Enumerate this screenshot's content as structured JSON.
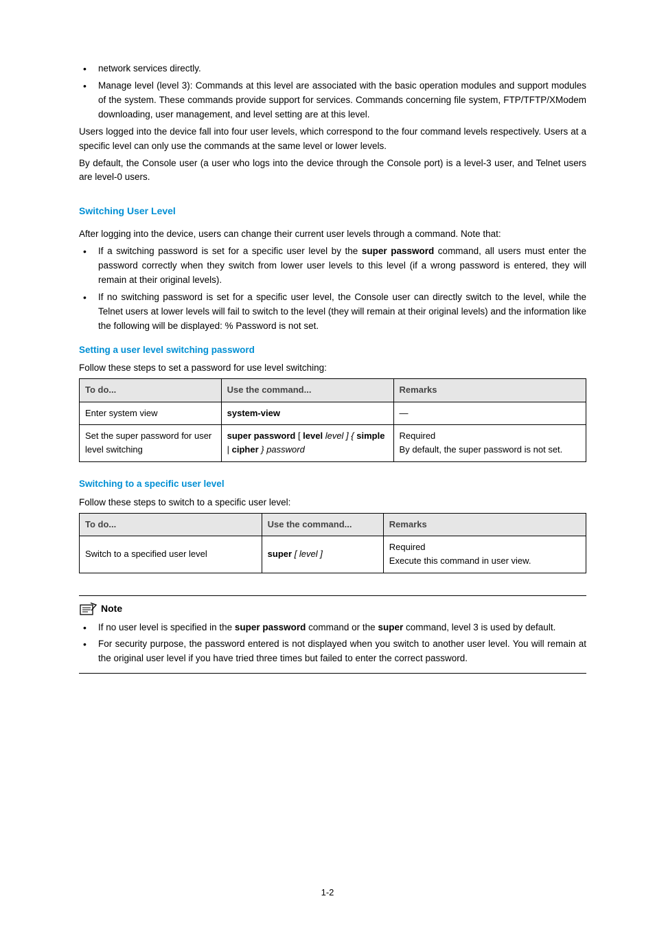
{
  "intro": {
    "bullet1_pre": "network services directly.",
    "bullet2": "Manage level (level 3): Commands at this level are associated with the basic operation modules and support modules of the system. These commands provide support for services. Commands concerning file system, FTP/TFTP/XModem downloading, user management, and level setting are at this level.",
    "p1": "Users logged into the device fall into four user levels, which correspond to the four command levels respectively. Users at a specific level can only use the commands at the same level or lower levels.",
    "p2": "By default, the Console user (a user who logs into the device through the Console port) is a level-3 user, and Telnet users are level-0 users."
  },
  "switching": {
    "heading": "Switching User Level",
    "p1": "After logging into the device, users can change their current user levels through a command. Note that:",
    "bullet1_a": "If a switching password is set for a specific user level by the ",
    "bullet1_cmd": "super password",
    "bullet1_b": " command, all users must enter the password correctly when they switch from lower user levels to this level (if a wrong password is entered, they will remain at their original levels).",
    "bullet2": "If no switching password is set for a specific user level, the Console user can directly switch to the level, while the Telnet users at lower levels will fail to switch to the level (they will remain at their original levels) and the information like the following will be displayed: % Password is not set."
  },
  "table1": {
    "sub": "Setting a user level switching password",
    "caption": "Follow these steps to set a password for use level switching:",
    "headers": [
      "To do...",
      "Use the command...",
      "Remarks"
    ],
    "row1": {
      "c1": "Enter system view",
      "c2": "system-view",
      "c3": "—"
    },
    "row2": {
      "c1": "Set the super password for user level switching",
      "c2_a": "super password",
      "c2_b": " [ ",
      "c2_c": "level",
      "c2_d": " level ] { ",
      "c2_e": "simple",
      "c2_f": " | ",
      "c2_g": "cipher",
      "c2_h": " } password",
      "c3_a": "Required",
      "c3_b": "By default, the super password is not set."
    }
  },
  "table2": {
    "sub": "Switching to a specific user level",
    "caption": "Follow these steps to switch to a specific user level:",
    "headers": [
      "To do...",
      "Use the command...",
      "Remarks"
    ],
    "row1": {
      "c1": "Switch to a specified user level",
      "c2_a": "super",
      "c2_b": " [ level ]",
      "c3_a": "Required",
      "c3_b": "Execute this command in user view."
    }
  },
  "note": {
    "label": "Note",
    "b1_a": "If no user level is specified in the ",
    "b1_cmd1": "super password",
    "b1_b": " command or the ",
    "b1_cmd2": "super",
    "b1_c": " command, level 3 is used by default.",
    "b2": "For security purpose, the password entered is not displayed when you switch to another user level. You will remain at the original user level if you have tried three times but failed to enter the correct password."
  },
  "page_num": "1-2"
}
